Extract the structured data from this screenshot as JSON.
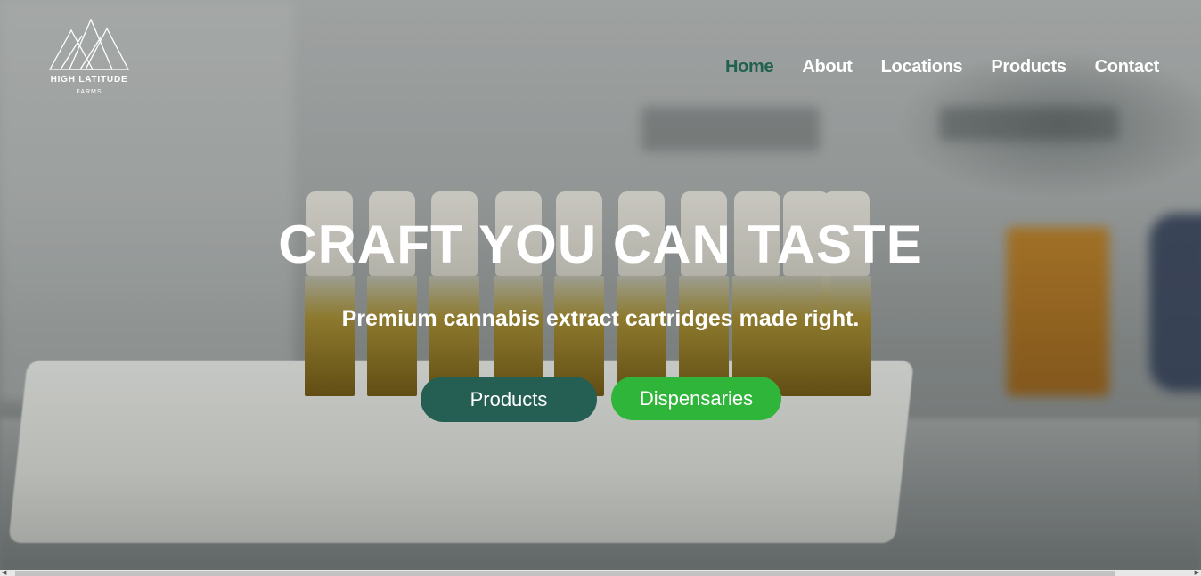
{
  "brand": {
    "name": "HIGH LATITUDE",
    "sub": "FARMS"
  },
  "nav": {
    "items": [
      {
        "label": "Home",
        "active": true
      },
      {
        "label": "About"
      },
      {
        "label": "Locations"
      },
      {
        "label": "Products"
      },
      {
        "label": "Contact"
      }
    ]
  },
  "hero": {
    "headline": "CRAFT YOU CAN TASTE",
    "subhead": "Premium cannabis extract cartridges made right.",
    "buttons": {
      "products": "Products",
      "dispensaries": "Dispensaries"
    }
  },
  "colors": {
    "accent_dark": "#255e52",
    "accent_green": "#2fb53a",
    "nav_active": "#22614f"
  },
  "icons": {
    "logo": "mountains-logo-icon",
    "scroll_left": "arrow-left-icon",
    "scroll_right": "arrow-right-icon"
  }
}
